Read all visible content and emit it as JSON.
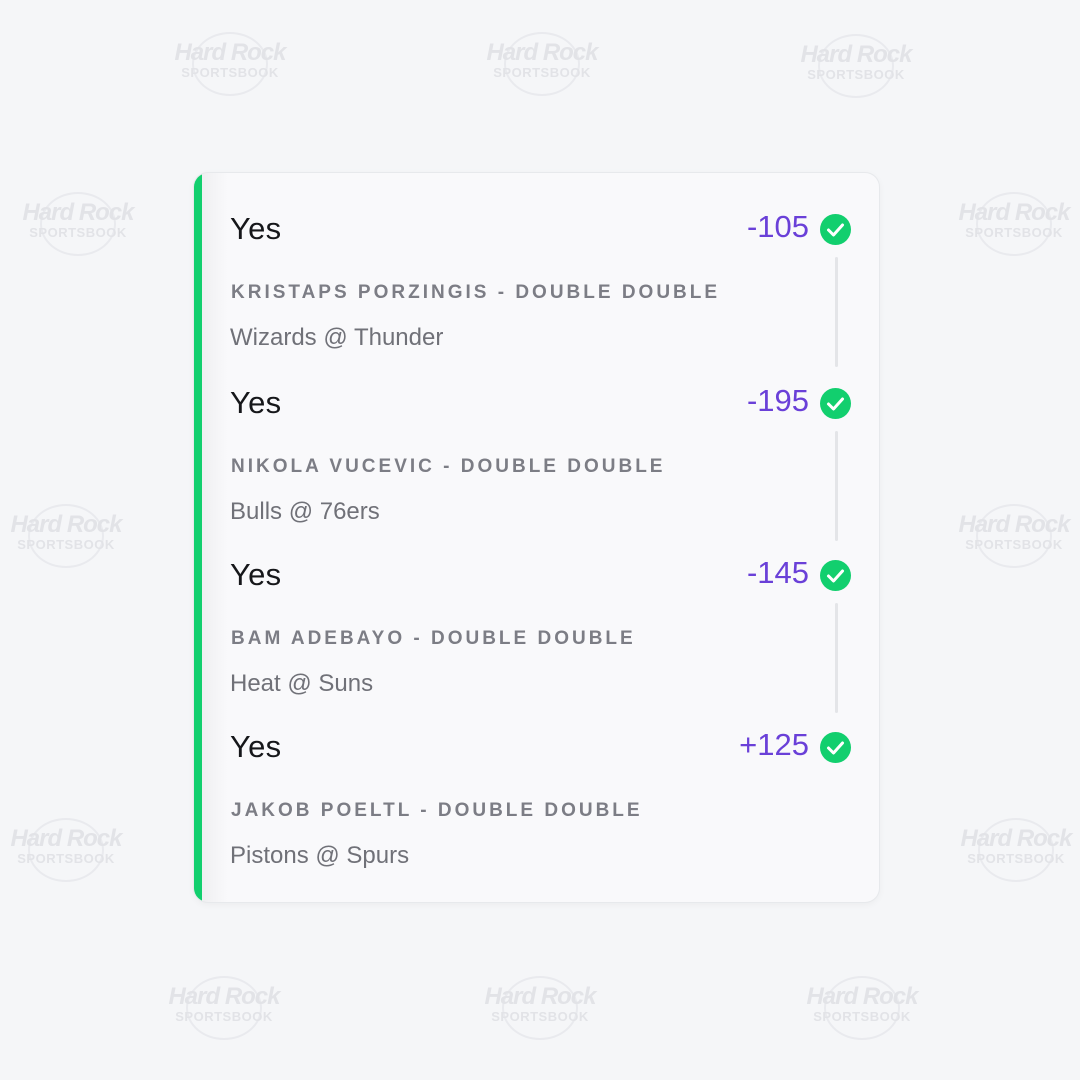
{
  "watermark": {
    "line1": "Hard Rock",
    "line2": "SPORTSBOOK"
  },
  "colors": {
    "accent": "#12cf6e",
    "odds": "#6a40d8",
    "check": "#12cf6e"
  },
  "legs": [
    {
      "selection": "Yes",
      "odds": "-105",
      "market": "KRISTAPS PORZINGIS - DOUBLE DOUBLE",
      "event": "Wizards @ Thunder",
      "status_icon": "check-circle-icon"
    },
    {
      "selection": "Yes",
      "odds": "-195",
      "market": "NIKOLA VUCEVIC - DOUBLE DOUBLE",
      "event": "Bulls @ 76ers",
      "status_icon": "check-circle-icon"
    },
    {
      "selection": "Yes",
      "odds": "-145",
      "market": "BAM ADEBAYO - DOUBLE DOUBLE",
      "event": "Heat @ Suns",
      "status_icon": "check-circle-icon"
    },
    {
      "selection": "Yes",
      "odds": "+125",
      "market": "JAKOB POELTL - DOUBLE DOUBLE",
      "event": "Pistons @ Spurs",
      "status_icon": "check-circle-icon"
    }
  ]
}
